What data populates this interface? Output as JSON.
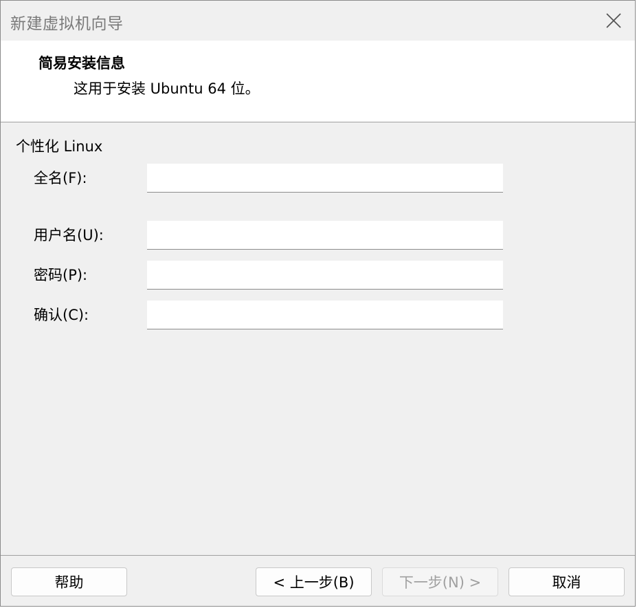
{
  "window": {
    "title": "新建虚拟机向导",
    "close_icon": "close-icon"
  },
  "header": {
    "title": "简易安装信息",
    "subtitle": "这用于安装 Ubuntu 64 位。"
  },
  "section": {
    "title": "个性化 Linux"
  },
  "fields": {
    "fullname": {
      "label": "全名(F):",
      "value": ""
    },
    "username": {
      "label": "用户名(U):",
      "value": ""
    },
    "password": {
      "label": "密码(P):",
      "value": ""
    },
    "confirm": {
      "label": "确认(C):",
      "value": ""
    }
  },
  "buttons": {
    "help": "帮助",
    "back": "< 上一步(B)",
    "next": "下一步(N) >",
    "cancel": "取消"
  }
}
